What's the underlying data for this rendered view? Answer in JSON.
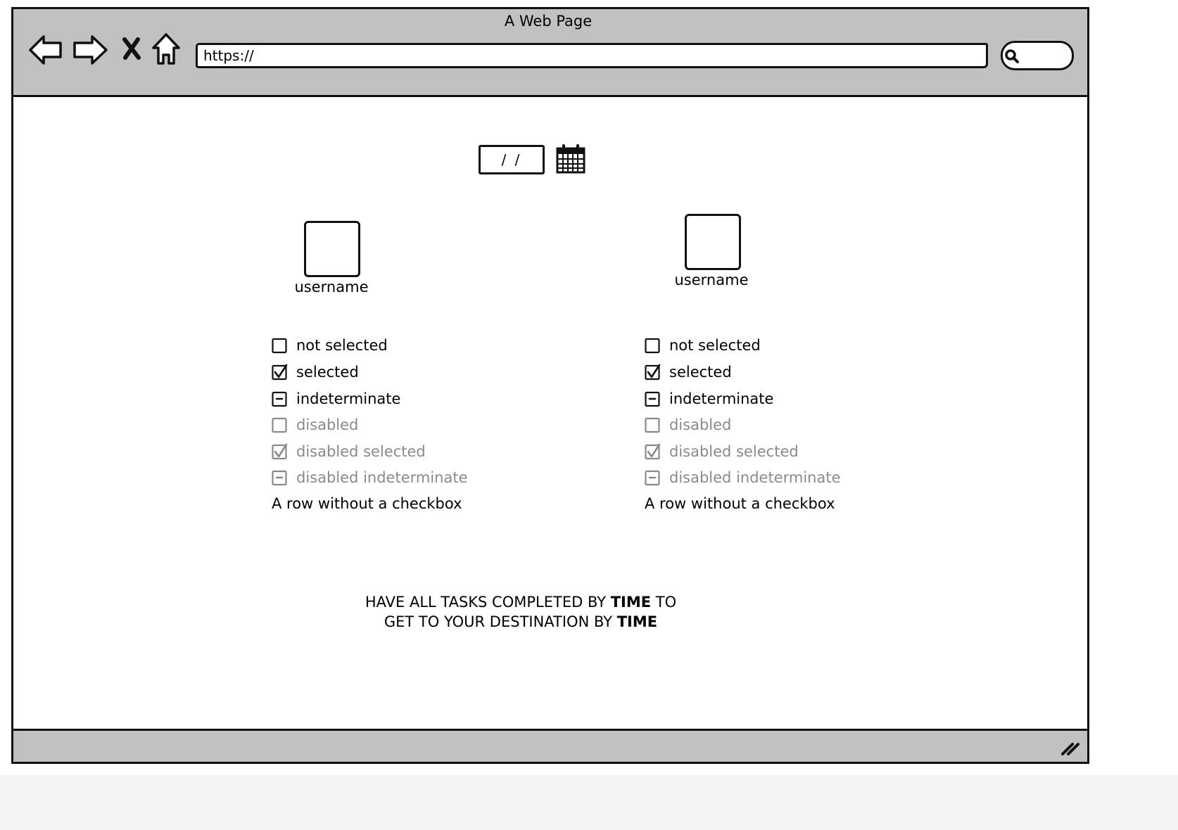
{
  "browser": {
    "title": "A Web Page",
    "url": "https://",
    "buttons": {
      "back": "back-icon",
      "forward": "forward-icon",
      "stop": "close-icon",
      "home": "home-icon"
    },
    "search_icon": "search-icon"
  },
  "date_picker": {
    "value": "/ /",
    "icon": "calendar-icon"
  },
  "columns": [
    {
      "avatar_label": "username",
      "checkboxes": [
        {
          "label": "not selected",
          "state": "unchecked",
          "disabled": false
        },
        {
          "label": "selected",
          "state": "checked",
          "disabled": false
        },
        {
          "label": "indeterminate",
          "state": "indeterminate",
          "disabled": false
        },
        {
          "label": "disabled",
          "state": "unchecked",
          "disabled": true
        },
        {
          "label": "disabled selected",
          "state": "checked",
          "disabled": true
        },
        {
          "label": "disabled indeterminate",
          "state": "indeterminate",
          "disabled": true
        }
      ],
      "plain_row": "A row without a checkbox"
    },
    {
      "avatar_label": "username",
      "checkboxes": [
        {
          "label": "not selected",
          "state": "unchecked",
          "disabled": false
        },
        {
          "label": "selected",
          "state": "checked",
          "disabled": false
        },
        {
          "label": "indeterminate",
          "state": "indeterminate",
          "disabled": false
        },
        {
          "label": "disabled",
          "state": "unchecked",
          "disabled": true
        },
        {
          "label": "disabled selected",
          "state": "checked",
          "disabled": true
        },
        {
          "label": "disabled indeterminate",
          "state": "indeterminate",
          "disabled": true
        }
      ],
      "plain_row": "A row without a checkbox"
    }
  ],
  "message": {
    "line1_a": "HAVE ALL TASKS COMPLETED BY ",
    "line1_bold": "TIME",
    "line1_b": " TO",
    "line2_a": "GET TO YOUR DESTINATION BY ",
    "line2_bold": "TIME"
  },
  "colors": {
    "chrome": "#c1c1c1",
    "stroke": "#111111",
    "disabled_text": "#8a8a8a"
  }
}
